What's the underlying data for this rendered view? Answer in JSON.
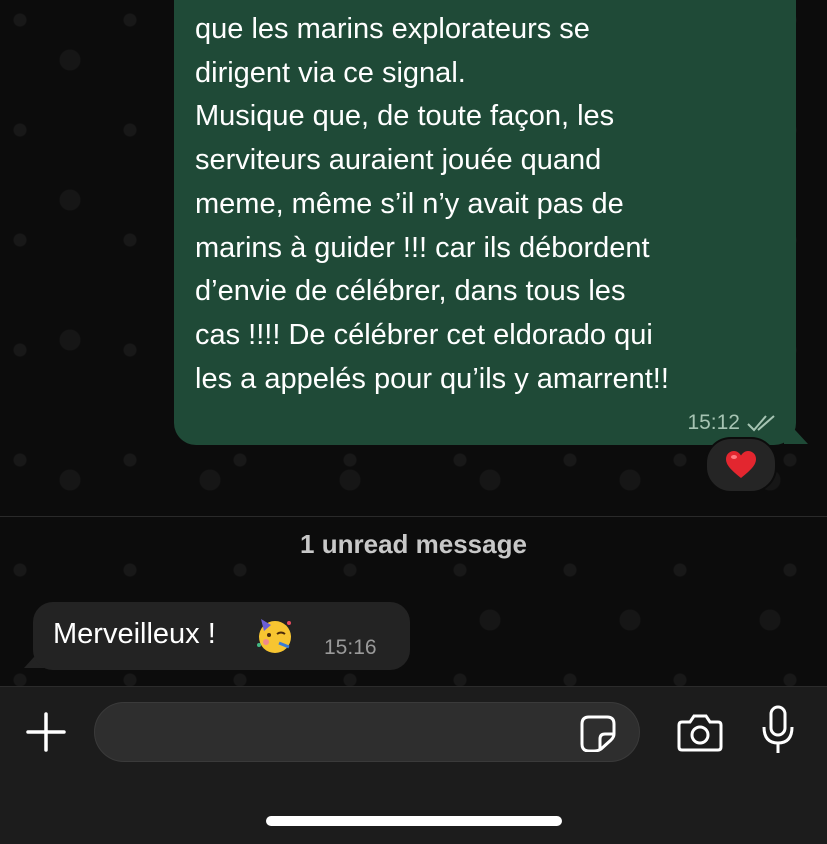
{
  "messages": {
    "outgoing": {
      "text": "que les marins explorateurs se\ndirigent via ce signal.\nMusique que, de toute façon, les\nserviteurs auraient jouée quand\nmeme, même s’il n’y avait pas de\nmarins à guider !!! car ils débordent\nd’envie de célébrer, dans tous les\ncas !!!! De célébrer cet eldorado qui\nles a appelés pour qu’ils y amarrent!!",
      "time": "15:12",
      "status_icon": "double-check-icon",
      "reaction": "❤️",
      "bubble_color": "#1f4a37"
    },
    "unread_divider": "1 unread message",
    "incoming": {
      "text": "Merveilleux !",
      "emoji_icon": "partying-face-emoji",
      "time": "15:16",
      "bubble_color": "#232323"
    }
  },
  "composer": {
    "placeholder": "",
    "plus_icon": "plus-icon",
    "sticker_icon": "sticker-icon",
    "camera_icon": "camera-icon",
    "mic_icon": "microphone-icon"
  }
}
